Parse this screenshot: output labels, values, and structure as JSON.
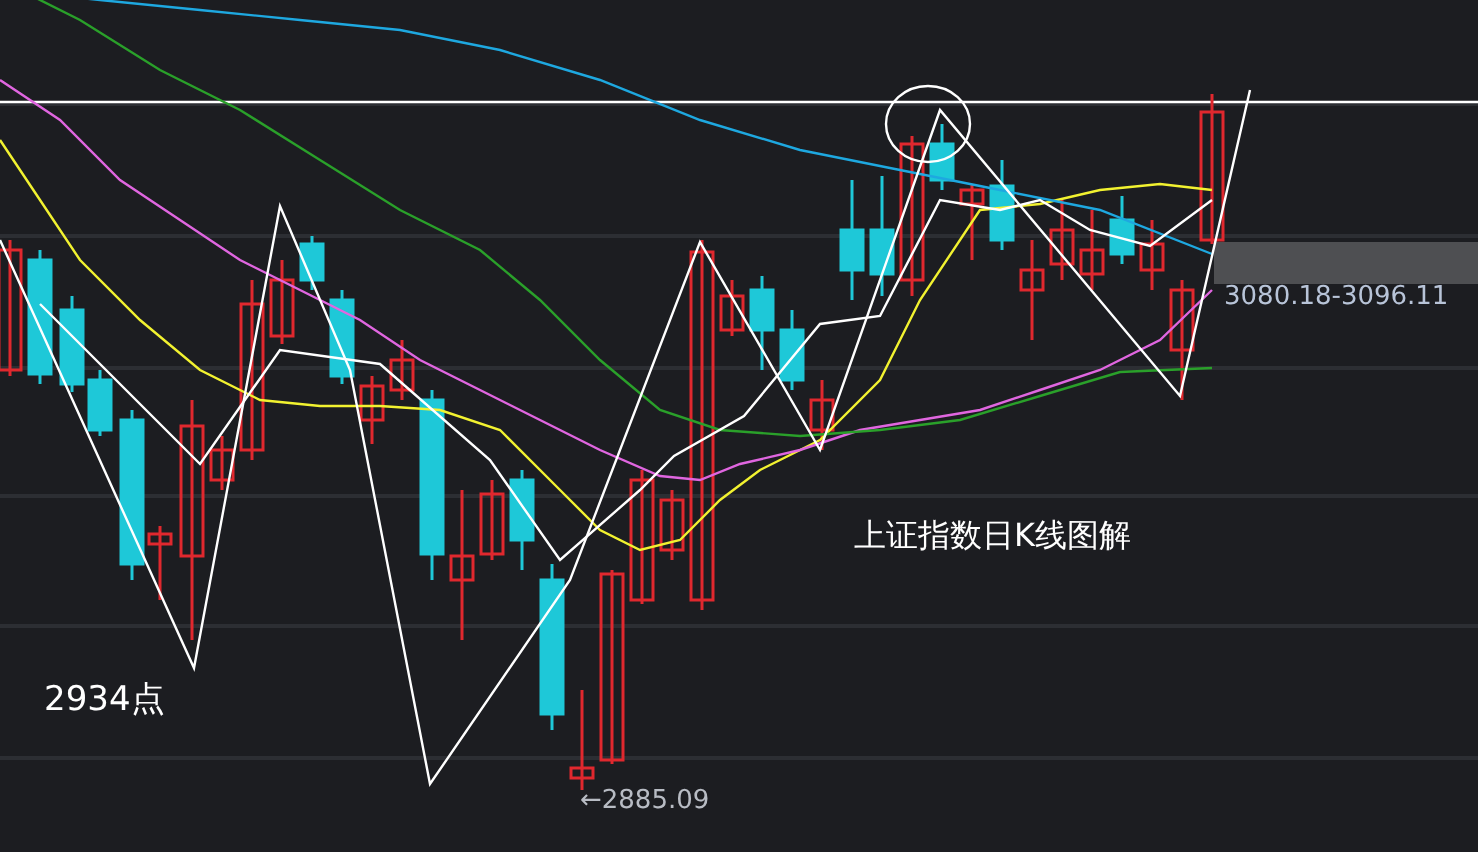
{
  "chart": {
    "title": "上证指数日K线图解",
    "left_low_label": "2934点",
    "bottom_low_label": "←2885.09",
    "range_label": "3080.18-3096.11"
  }
}
